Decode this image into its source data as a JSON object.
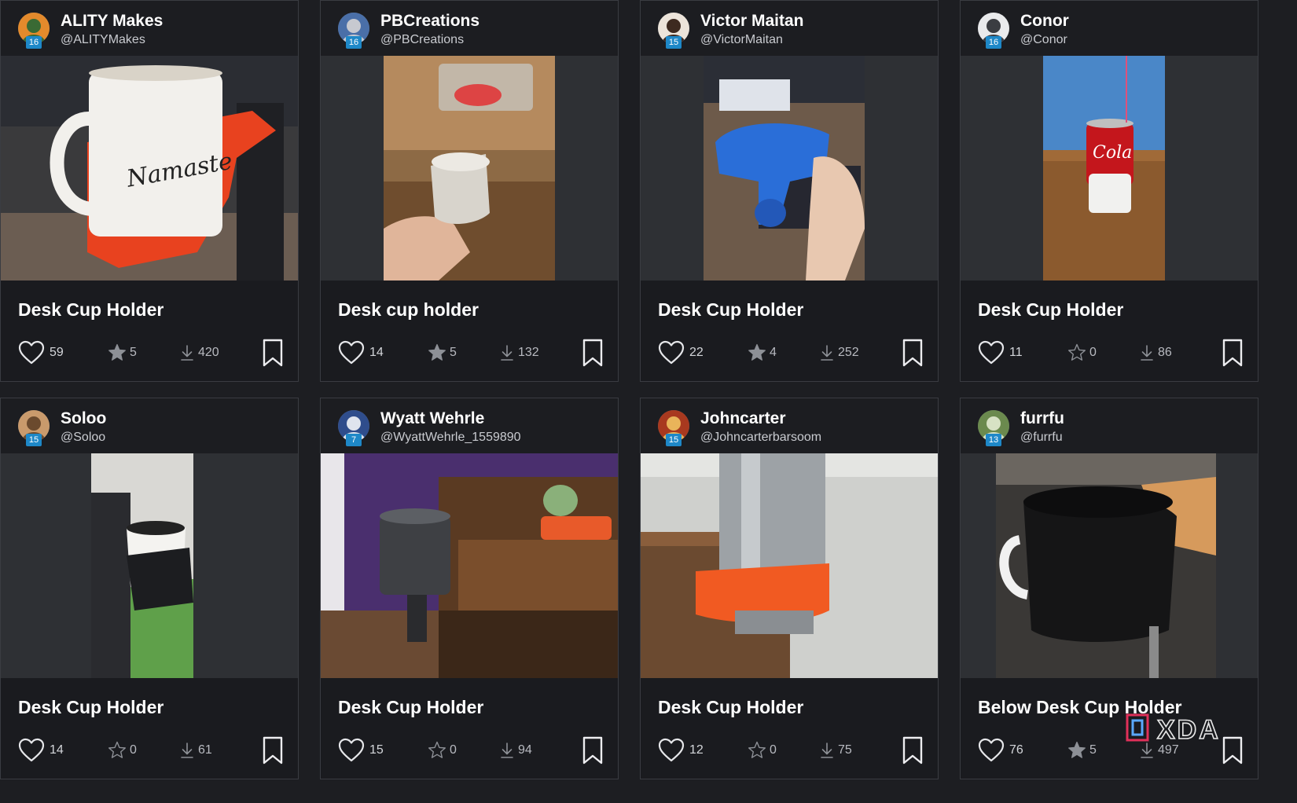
{
  "cards": [
    {
      "user": {
        "name": "ALITY Makes",
        "handle": "@ALITYMakes",
        "level": "16"
      },
      "title": "Desk Cup Holder",
      "likes": "59",
      "stars": "5",
      "star_state": "filled",
      "downloads": "420",
      "image": "white Namaste mug in red 3D-printed desk cup holder"
    },
    {
      "user": {
        "name": "PBCreations",
        "handle": "@PBCreations",
        "level": "16"
      },
      "title": "Desk cup holder",
      "likes": "14",
      "stars": "5",
      "star_state": "filled",
      "downloads": "132",
      "image": "hand holding white printed cup holder over desk"
    },
    {
      "user": {
        "name": "Victor Maitan",
        "handle": "@VictorMaitan",
        "level": "15"
      },
      "title": "Desk Cup Holder",
      "likes": "22",
      "stars": "4",
      "star_state": "filled",
      "downloads": "252",
      "image": "hand holding blue printed clamp cup holder"
    },
    {
      "user": {
        "name": "Conor",
        "handle": "@Conor",
        "level": "16"
      },
      "title": "Desk Cup Holder",
      "likes": "11",
      "stars": "0",
      "star_state": "empty",
      "downloads": "86",
      "image": "red soda can in white holder on wooden desk"
    },
    {
      "user": {
        "name": "Soloo",
        "handle": "@Soloo",
        "level": "15"
      },
      "title": "Desk Cup Holder",
      "likes": "14",
      "stars": "0",
      "star_state": "empty",
      "downloads": "61",
      "image": "white mug in black holder attached to desk"
    },
    {
      "user": {
        "name": "Wyatt Wehrle",
        "handle": "@WyattWehrle_1559890",
        "level": "7"
      },
      "title": "Desk Cup Holder",
      "likes": "15",
      "stars": "0",
      "star_state": "empty",
      "downloads": "94",
      "image": "black cylindrical holder clamped to wooden desk"
    },
    {
      "user": {
        "name": "Johncarter",
        "handle": "@Johncarterbarsoom",
        "level": "15"
      },
      "title": "Desk Cup Holder",
      "likes": "12",
      "stars": "0",
      "star_state": "empty",
      "downloads": "75",
      "image": "steel tumbler in orange under-desk holder"
    },
    {
      "user": {
        "name": "furrfu",
        "handle": "@furrfu",
        "level": "13"
      },
      "title": "Below Desk Cup Holder",
      "likes": "76",
      "stars": "5",
      "star_state": "filled",
      "downloads": "497",
      "image": "black mug with white handle in black holder under desk"
    }
  ],
  "watermark": "XDA",
  "colors": {
    "background": "#1d1e22",
    "card": "#1a1b1f",
    "level_badge": "#1e88c8",
    "stat_text": "#b8bac0"
  }
}
